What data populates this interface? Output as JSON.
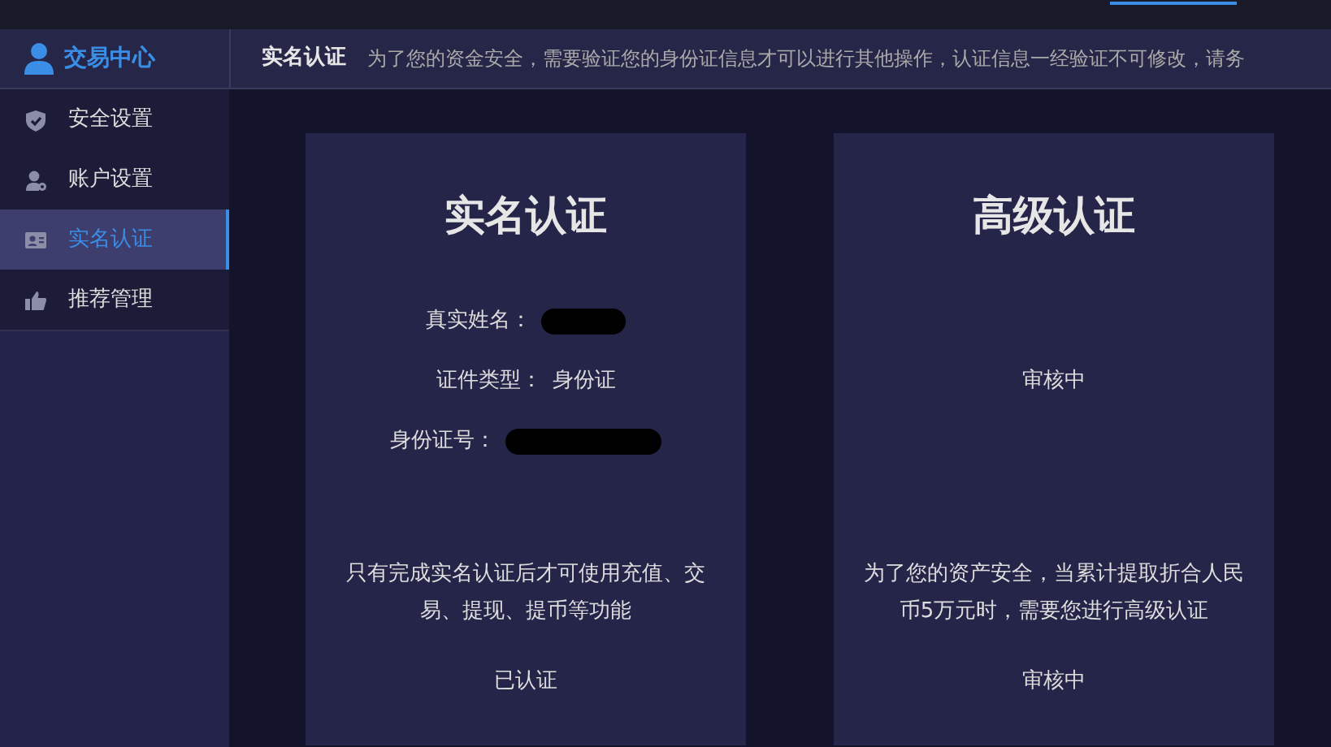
{
  "sidebar": {
    "title": "交易中心",
    "items": [
      {
        "label": "安全设置",
        "selected": false
      },
      {
        "label": "账户设置",
        "selected": false
      },
      {
        "label": "实名认证",
        "selected": true
      },
      {
        "label": "推荐管理",
        "selected": false
      }
    ]
  },
  "header": {
    "title": "实名认证",
    "notice": "为了您的资金安全，需要验证您的身份证信息才可以进行其他操作，认证信息一经验证不可修改，请务"
  },
  "cards": [
    {
      "title": "实名认证",
      "fields": [
        {
          "label": "真实姓名：",
          "kind": "redacted"
        },
        {
          "label": "证件类型：",
          "value": "身份证",
          "kind": "text"
        },
        {
          "label": "身份证号：",
          "kind": "redacted"
        }
      ],
      "description": "只有完成实名认证后才可使用充值、交易、提现、提币等功能",
      "status": "已认证"
    },
    {
      "title": "高级认证",
      "fields": [
        {
          "value": "审核中",
          "kind": "text"
        }
      ],
      "description": "为了您的资产安全，当累计提取折合人民币5万元时，需要您进行高级认证",
      "status": "审核中"
    }
  ]
}
